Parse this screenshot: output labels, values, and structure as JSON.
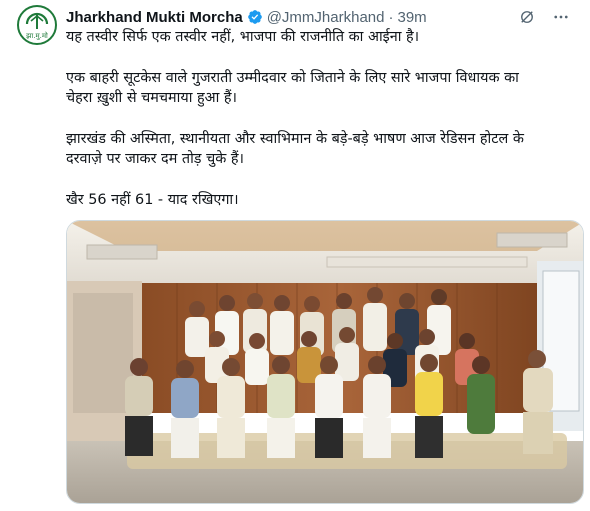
{
  "tweet": {
    "author": {
      "display_name": "Jharkhand Mukti Morcha",
      "handle": "@JmmJharkhand",
      "verified": true,
      "avatar_icon": "jmm-logo-icon",
      "avatar_text": "झा.मु.मो"
    },
    "separator": "·",
    "time": "39m",
    "text": {
      "line1": "यह तस्वीर सिर्फ एक तस्वीर नहीं, भाजपा की राजनीति का आईना है।",
      "line2": "एक बाहरी सूटकेस वाले गुजराती उम्मीदवार को जिताने के लिए सारे भाजपा विधायक का",
      "line3": "चेहरा ख़ुशी से चमचमाया हुआ हैं।",
      "line4": "झारखंड की अस्मिता, स्थानीयता और स्वाभिमान के बड़े-बड़े भाषण आज रेडिसन होटल के",
      "line5": "दरवाज़े पर जाकर दम तोड़ चुके हैं।",
      "line6": "खैर 56 नहीं 61 - याद रखिएगा।"
    },
    "header_icons": [
      "grok-icon",
      "more-icon"
    ],
    "photo": {
      "subject": "group-photo-icon"
    }
  },
  "colors": {
    "verified": "#1d9bf0",
    "secondary_text": "#536471",
    "logo_green": "#1f7a3a",
    "wood": "#9a5a2e"
  }
}
